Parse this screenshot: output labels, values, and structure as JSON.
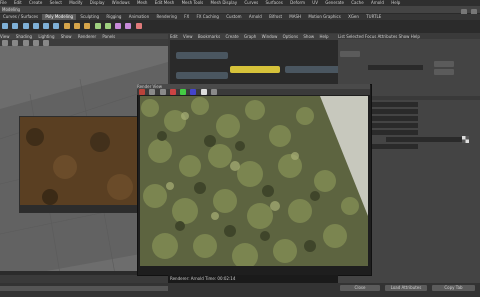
{
  "menubar": {
    "items": [
      "File",
      "Edit",
      "Create",
      "Select",
      "Modify",
      "Display",
      "Windows",
      "Mesh",
      "Edit Mesh",
      "Mesh Tools",
      "Mesh Display",
      "Curves",
      "Surfaces",
      "Deform",
      "UV",
      "Generate",
      "Cache",
      "Arnold",
      "Help"
    ]
  },
  "status": {
    "mode": "Modeling"
  },
  "shelf": {
    "tabs": [
      "Curves / Surfaces",
      "Poly Modeling",
      "Sculpting",
      "Rigging",
      "Animation",
      "Rendering",
      "FX",
      "FX Caching",
      "Custom",
      "Arnold",
      "Bifrost",
      "MASH",
      "Motion Graphics",
      "XGen",
      "TURTLE"
    ],
    "active": 1
  },
  "viewport": {
    "menu": [
      "View",
      "Shading",
      "Lighting",
      "Show",
      "Renderer",
      "Panels"
    ]
  },
  "node_editor": {
    "menu": [
      "Edit",
      "View",
      "Bookmarks",
      "Create",
      "Graph",
      "Window",
      "Options",
      "Show",
      "Help"
    ]
  },
  "attribute_editor": {
    "tabs": [
      "List",
      "Selected",
      "Focus",
      "Attributes",
      "Show",
      "Help"
    ],
    "rows": [
      "Color",
      "Tint",
      "Ambient",
      "Transparency",
      "Incandescence",
      "Bump Mapping",
      "Diffuse"
    ]
  },
  "render_view": {
    "title": "Render View",
    "status": "Renderer: Arnold   Time: 00:02:14"
  },
  "bottom": {
    "buttons": [
      "Load Attributes",
      "Copy Tab",
      "Close"
    ]
  }
}
